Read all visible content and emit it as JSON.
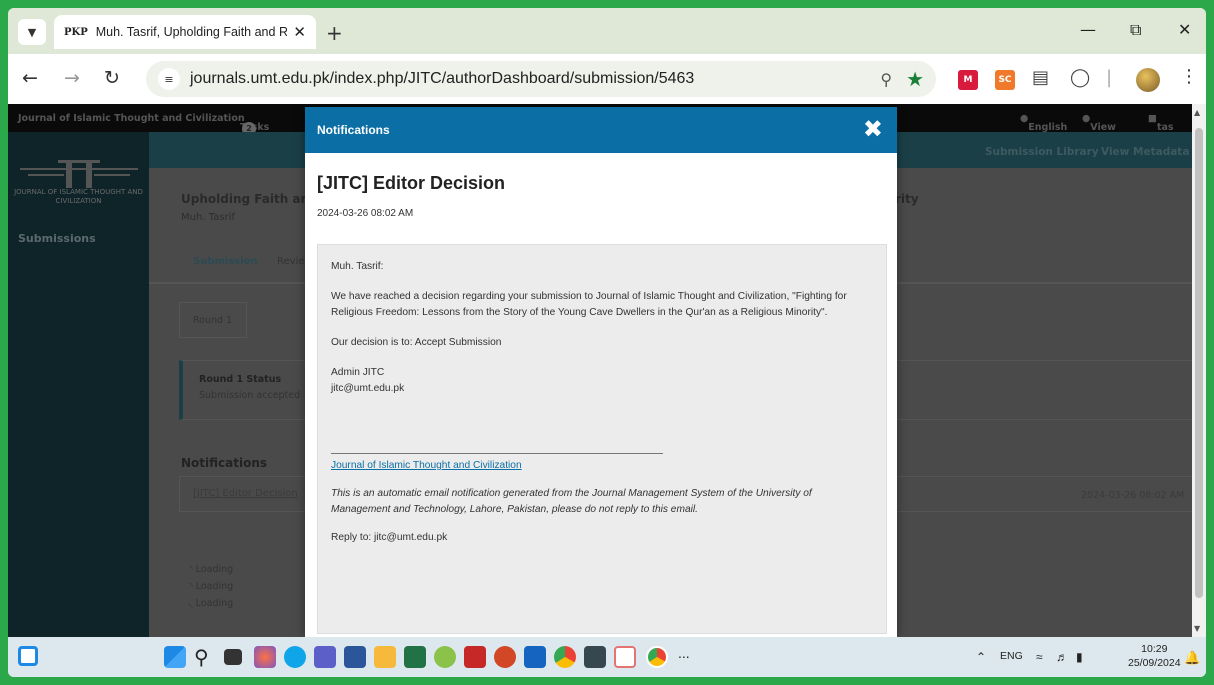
{
  "browser": {
    "tab_title": "Muh. Tasrif, Upholding Faith and Relig",
    "tab_favicon": "PKP",
    "url": "journals.umt.edu.pk/index.php/JITC/authorDashboard/submission/5463",
    "extension_sc": "SC"
  },
  "site": {
    "journal_name": "Journal of Islamic Thought and Civilization",
    "tasks_label": "Tasks",
    "tasks_count": "2",
    "lang": "English",
    "view_site": "View Site",
    "user": "tas",
    "logo_text": "JOURNAL OF ISLAMIC THOUGHT AND CIVILIZATION",
    "sidebar_submissions": "Submissions",
    "submission_library": "Submission Library",
    "view_metadata": "View Metadata",
    "submission_title_partial": "Upholding Faith and R",
    "submission_title_suffix": "rity",
    "author": "Muh. Tasrif",
    "tab_submission": "Submission",
    "tab_review": "Review",
    "round": "Round 1",
    "round_status_title": "Round 1 Status",
    "round_status_value": "Submission accepted",
    "notifications_heading": "Notifications",
    "notification_item": "[JITC] Editor Decision",
    "notification_date": "2024-03-26 08:02 AM",
    "loading": [
      "Loading",
      "Loading",
      "Loading"
    ]
  },
  "modal": {
    "header": "Notifications",
    "subject": "[JITC] Editor Decision",
    "date": "2024-03-26 08:02 AM",
    "greeting": "Muh. Tasrif:",
    "paragraph1": "We have reached a decision regarding your submission to Journal of Islamic Thought and Civilization, \"Fighting for Religious Freedom: Lessons from the Story of the Young Cave Dwellers in the Qur'an as a Religious Minority\".",
    "decision": "Our decision is to: Accept Submission",
    "sender_name": "Admin JITC",
    "sender_email": "jitc@umt.edu.pk",
    "journal_link": "Journal of Islamic Thought and Civilization",
    "footer_note": "This is an automatic email notification generated from the Journal Management System of the University of Management and Technology, Lahore, Pakistan, please do not reply to this email.",
    "reply_to": "Reply to: jitc@umt.edu.pk"
  },
  "taskbar": {
    "lang": "ENG",
    "time": "10:29",
    "date": "25/09/2024",
    "more": "..."
  }
}
